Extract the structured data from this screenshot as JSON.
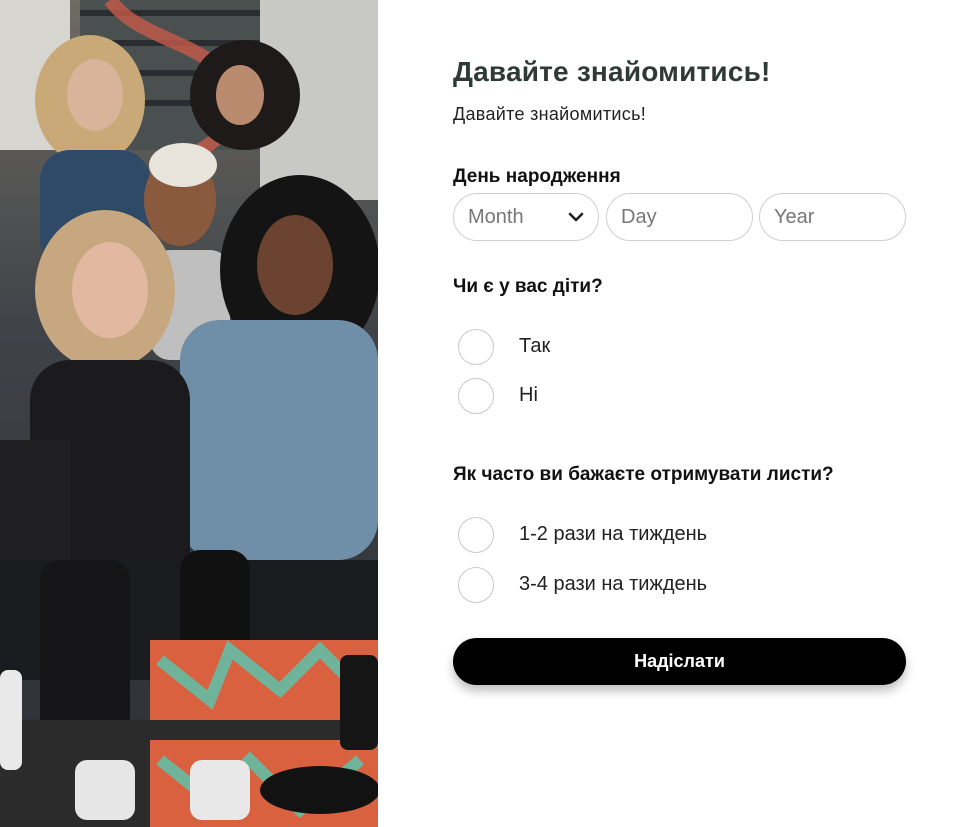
{
  "form": {
    "title": "Давайте знайомитись!",
    "subtitle": "Давайте знайомитись!",
    "dob": {
      "label": "День народження",
      "month_placeholder": "Month",
      "day_placeholder": "Day",
      "year_placeholder": "Year"
    },
    "kids": {
      "label": "Чи є у вас діти?",
      "options": [
        "Так",
        "Ні"
      ]
    },
    "frequency": {
      "label": "Як часто ви бажаєте отримувати листи?",
      "options": [
        "1-2 рази на тиждень",
        "3-4 рази на тиждень"
      ]
    },
    "submit_label": "Надіслати"
  },
  "photo": {
    "icon": "group-photo-image"
  },
  "colors": {
    "button": "#000000",
    "title": "#2f3a36",
    "border": "#cfcfcf"
  }
}
